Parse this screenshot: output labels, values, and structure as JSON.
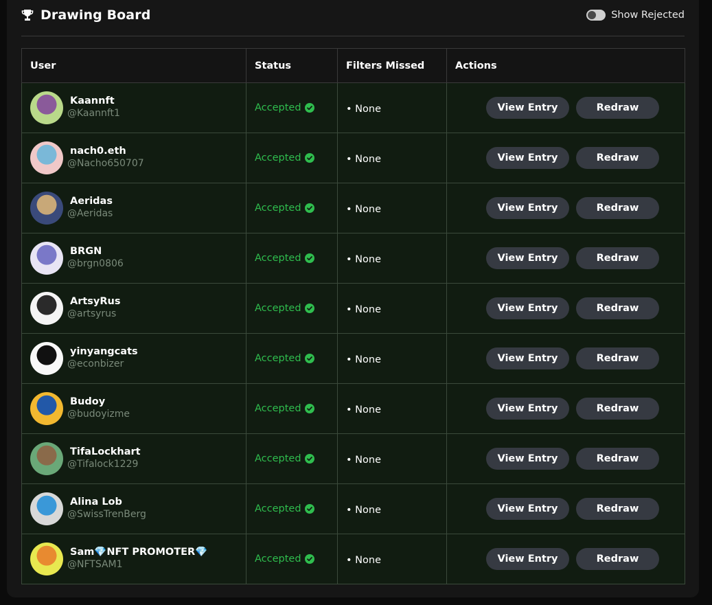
{
  "header": {
    "title": "Drawing Board",
    "icon": "trophy-icon",
    "toggle_label": "Show Rejected",
    "toggle_on": false
  },
  "table": {
    "columns": [
      "User",
      "Status",
      "Filters Missed",
      "Actions"
    ],
    "rows": [
      {
        "name": "Kaannft",
        "handle": "@Kaannft1",
        "status": "Accepted",
        "filters": "• None",
        "avatar_colors": [
          "#b9d98a",
          "#8a5a9a"
        ]
      },
      {
        "name": "nach0.eth",
        "handle": "@Nacho650707",
        "status": "Accepted",
        "filters": "• None",
        "avatar_colors": [
          "#f0c8c8",
          "#7ab8d8"
        ]
      },
      {
        "name": "Aeridas",
        "handle": "@Aeridas",
        "status": "Accepted",
        "filters": "• None",
        "avatar_colors": [
          "#3a4a7a",
          "#c8a878"
        ]
      },
      {
        "name": "BRGN",
        "handle": "@brgn0806",
        "status": "Accepted",
        "filters": "• None",
        "avatar_colors": [
          "#e8e4f4",
          "#7a78c8"
        ]
      },
      {
        "name": "ArtsyRus",
        "handle": "@artsyrus",
        "status": "Accepted",
        "filters": "• None",
        "avatar_colors": [
          "#f4f4f4",
          "#2a2a2a"
        ]
      },
      {
        "name": "yinyangcats",
        "handle": "@econbizer",
        "status": "Accepted",
        "filters": "• None",
        "avatar_colors": [
          "#f8f8f8",
          "#111111"
        ]
      },
      {
        "name": "Budoy",
        "handle": "@budoyizme",
        "status": "Accepted",
        "filters": "• None",
        "avatar_colors": [
          "#f2b830",
          "#2258a8"
        ]
      },
      {
        "name": "TifaLockhart",
        "handle": "@Tifalock1229",
        "status": "Accepted",
        "filters": "• None",
        "avatar_colors": [
          "#6aa878",
          "#8a6a4a"
        ]
      },
      {
        "name": "Alina Lob",
        "handle": "@SwissTrenBerg",
        "status": "Accepted",
        "filters": "• None",
        "avatar_colors": [
          "#d8d8d8",
          "#3a98d8"
        ]
      },
      {
        "name": "Sam💎NFT PROMOTER💎",
        "handle": "@NFTSAM1",
        "status": "Accepted",
        "filters": "• None",
        "avatar_colors": [
          "#e8e850",
          "#e88a30"
        ]
      }
    ],
    "view_label": "View Entry",
    "redraw_label": "Redraw"
  },
  "colors": {
    "accent_green": "#2fbd4e",
    "button_bg": "#363a42",
    "row_bg": "#111c11"
  }
}
